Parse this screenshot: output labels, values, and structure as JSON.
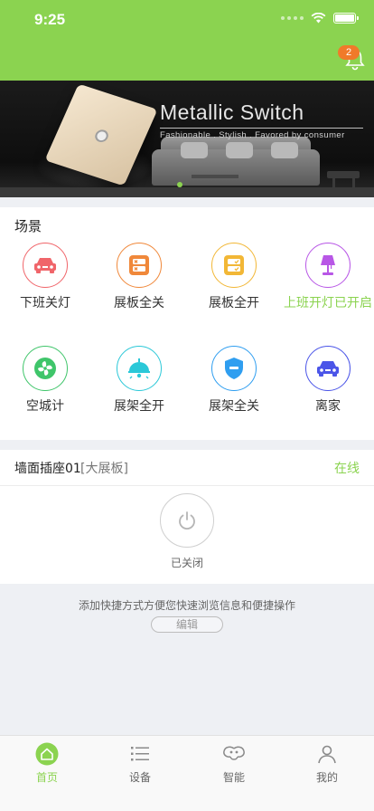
{
  "status_bar": {
    "time": "9:25"
  },
  "header": {
    "notification_count": "2"
  },
  "banner": {
    "title": "Metallic Switch",
    "subtitle": "Fashionable . Stylish . Favored by consumer"
  },
  "scenes": {
    "title": "场景",
    "items": [
      {
        "label": "下班关灯",
        "icon": "car-icon",
        "color": "#f0656a"
      },
      {
        "label": "展板全关",
        "icon": "panel-off-icon",
        "color": "#f0883a"
      },
      {
        "label": "展板全开",
        "icon": "panel-on-icon",
        "color": "#f2b736"
      },
      {
        "label": "上班开灯已开启",
        "icon": "lamp-icon",
        "color": "#b857e6",
        "label_color": "#8bd350"
      },
      {
        "label": "空城计",
        "icon": "fan-icon",
        "color": "#3fc56a"
      },
      {
        "label": "展架全开",
        "icon": "ceiling-lamp-icon",
        "color": "#2bc8d8"
      },
      {
        "label": "展架全关",
        "icon": "shield-icon",
        "color": "#2f9ef0"
      },
      {
        "label": "离家",
        "icon": "car-icon",
        "color": "#4b55e8"
      }
    ]
  },
  "device": {
    "name": "墙面插座01",
    "tag": "[大展板]",
    "status": "在线",
    "power_state": "已关闭"
  },
  "shortcut": {
    "hint": "添加快捷方式方便您快速浏览信息和便捷操作",
    "edit_label": "编辑"
  },
  "tabbar": {
    "items": [
      {
        "label": "首页",
        "icon": "home-icon",
        "active": true
      },
      {
        "label": "设备",
        "icon": "list-icon",
        "active": false
      },
      {
        "label": "智能",
        "icon": "smart-icon",
        "active": false
      },
      {
        "label": "我的",
        "icon": "user-icon",
        "active": false
      }
    ]
  },
  "colors": {
    "accent": "#8bd350",
    "badge": "#f07a2a"
  }
}
